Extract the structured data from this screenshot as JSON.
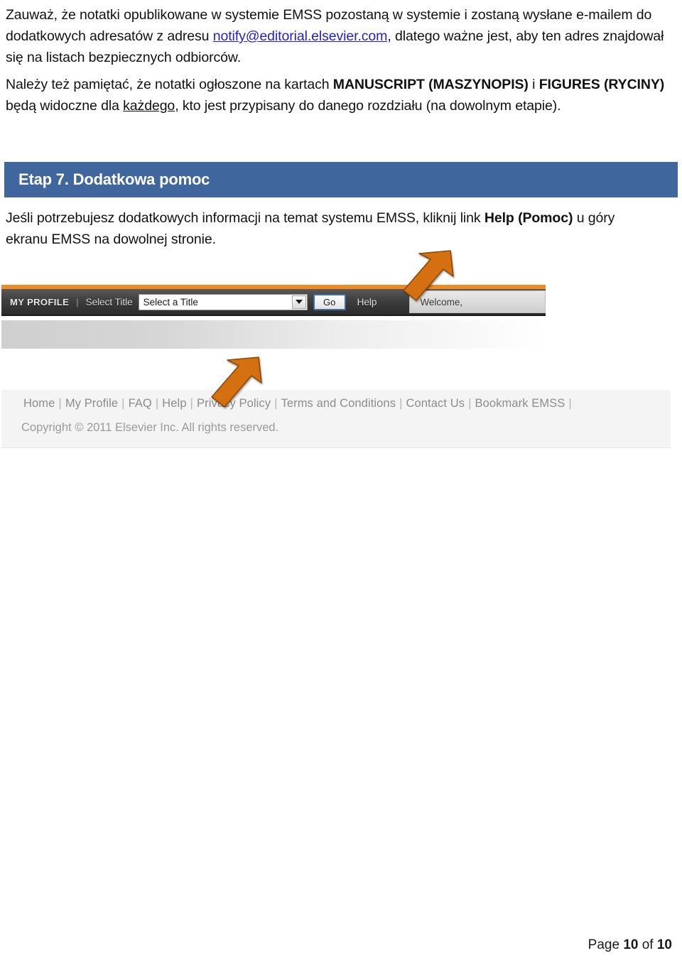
{
  "document": {
    "paragraph_1": {
      "before_link": "Zauważ, że notatki opublikowane w systemie EMSS pozostaną w systemie i zostaną wysłane e-mailem do dodatkowych adresatów z adresu ",
      "link_text": "notify@editorial.elsevier.com",
      "after_link": ", dlatego ważne jest, aby ten adres znajdował się na listach bezpiecznych odbiorców."
    },
    "paragraph_2": {
      "part_1": "Należy też pamiętać, że notatki ogłoszone na kartach ",
      "bold_1": "MANUSCRIPT (MASZYNOPIS)",
      "part_2": " i ",
      "bold_2": "FIGURES (RYCINY)",
      "part_3": " będą widoczne dla ",
      "underlined": "każdego",
      "part_4": ", kto jest przypisany do danego rozdziału (na dowolnym etapie)."
    },
    "section_heading": "Etap 7. Dodatkowa pomoc",
    "paragraph_3": {
      "part_1": "Jeśli potrzebujesz dodatkowych informacji na temat systemu EMSS, kliknij link ",
      "bold_1": "Help (Pomoc)",
      "part_2": " u góry ekranu EMSS na dowolnej stronie."
    },
    "page_footer": {
      "prefix": "Page ",
      "current": "10",
      "middle": " of ",
      "total": "10"
    }
  },
  "screenshot_toolbar": {
    "my_profile": "MY PROFILE",
    "separator": "|",
    "select_title_label": "Select Title",
    "select_value": "Select a Title",
    "go_button": "Go",
    "help_link": "Help",
    "welcome_text": "Welcome,"
  },
  "screenshot_footer": {
    "links": [
      "Home",
      "My Profile",
      "FAQ",
      "Help",
      "Privacy Policy",
      "Terms and Conditions",
      "Contact Us",
      "Bookmark EMSS"
    ],
    "separator": "|",
    "copyright": "Copyright © 2011 Elsevier Inc. All rights reserved."
  },
  "colors": {
    "section_bar_blue": "#40679d",
    "accent_orange": "#f08a22",
    "arrow_orange": "#d4700f",
    "link_blue": "#2222cc",
    "toolbar_dark": "#3e3e3e",
    "footer_grey": "#f4f4f4"
  }
}
